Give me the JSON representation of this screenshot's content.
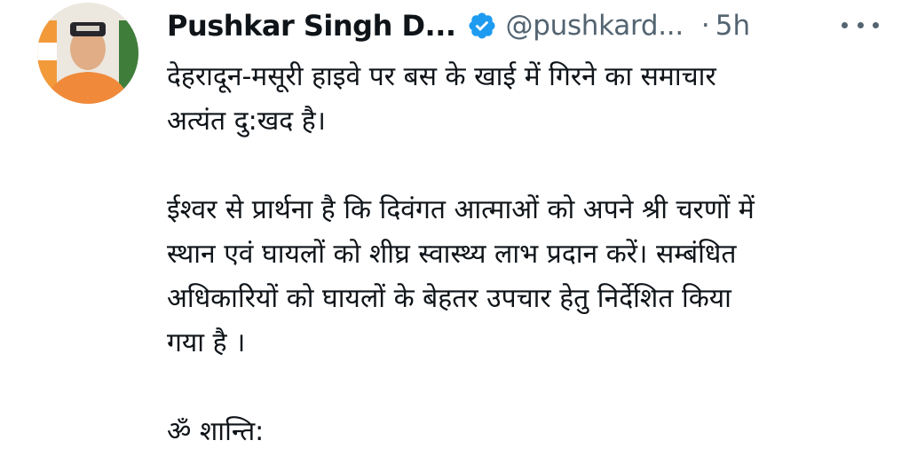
{
  "tweet": {
    "author_name": "Pushkar Singh D...",
    "handle": "@pushkard...",
    "separator": "·",
    "time": "5h",
    "lines": {
      "p1_l1": "देहरादून-मसूरी हाइवे पर बस के खाई में गिरने का समाचार",
      "p1_l2": "अत्यंत दु:खद है।",
      "p2_l1": "ईश्वर से प्रार्थना है कि दिवंगत आत्माओं को अपने श्री चरणों में",
      "p2_l2": "स्थान एवं घायलों को शीघ्र स्वास्थ्य लाभ प्रदान करें। सम्बंधित",
      "p2_l3": "अधिकारियों को घायलों के बेहतर उपचार हेतु निर्देशित किया",
      "p2_l4": "गया है ।",
      "p3_l1": "ॐ शान्ति:"
    },
    "icons": {
      "verified": "verified-badge-icon",
      "more": "more-options-icon",
      "avatar": "profile-avatar"
    },
    "colors": {
      "verified_blue": "#1d9bf0",
      "text_primary": "#0f1419",
      "text_secondary": "#536471"
    }
  }
}
